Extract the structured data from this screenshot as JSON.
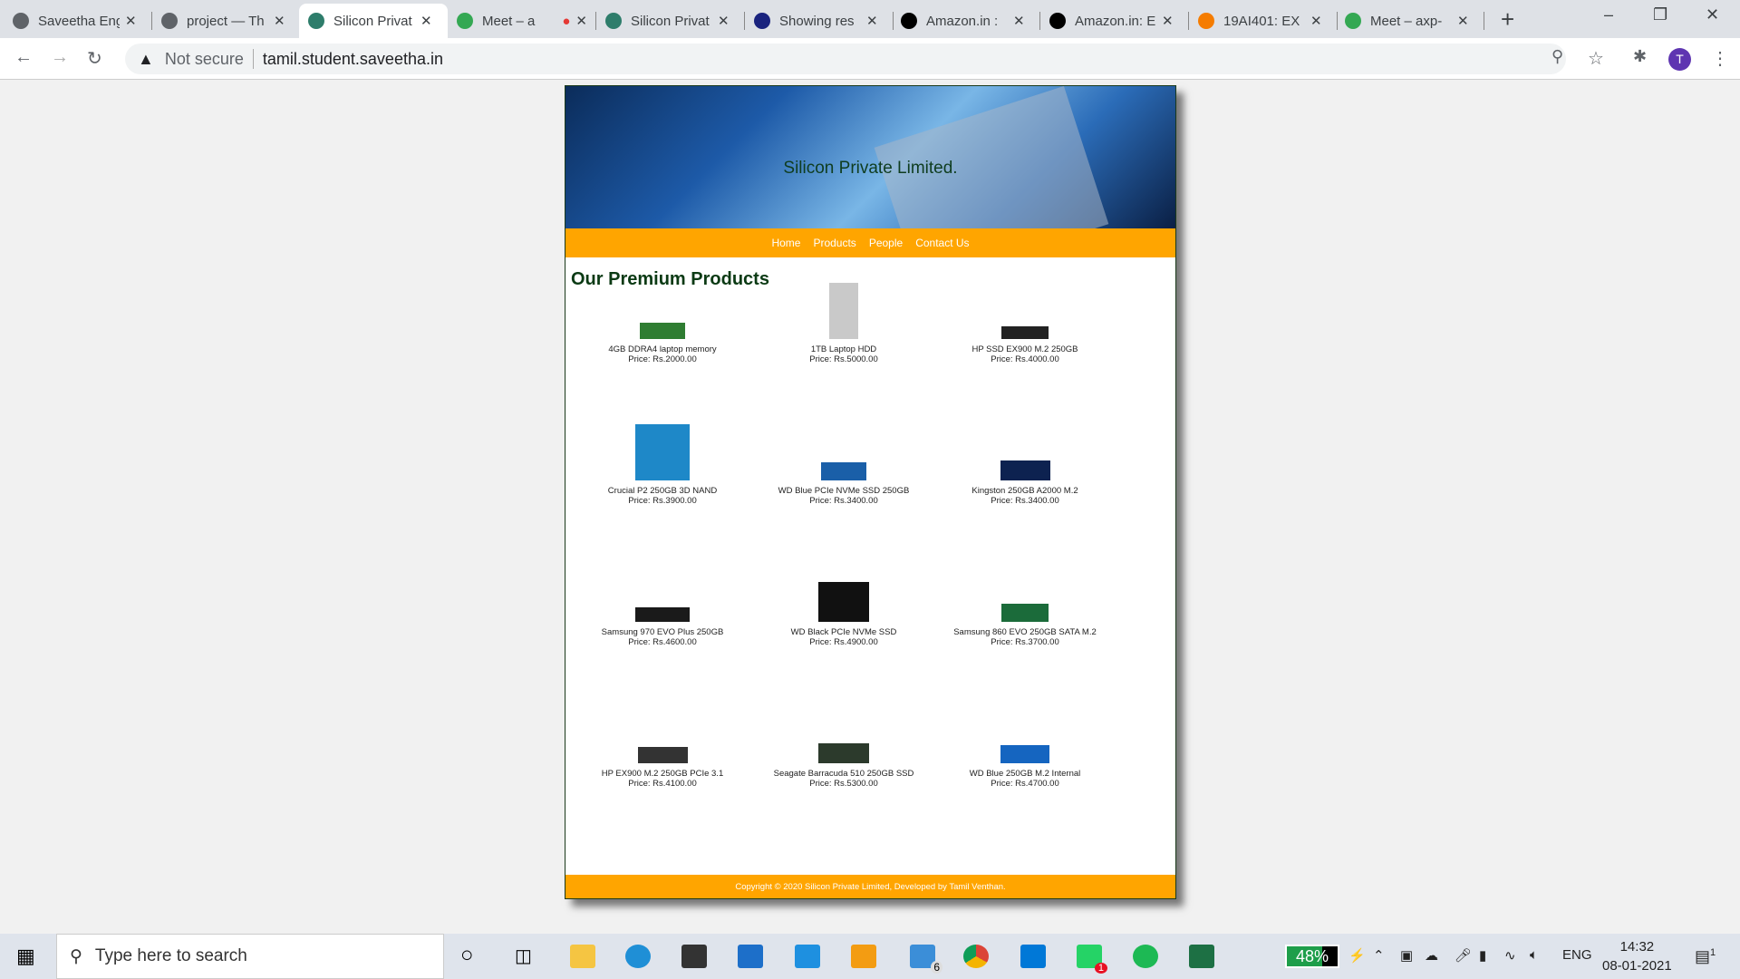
{
  "browser": {
    "tabs": [
      {
        "label": "Saveetha Eng",
        "icon": "globe-icon",
        "color": "#5f6368"
      },
      {
        "label": "project — Th",
        "icon": "globe-icon",
        "color": "#5f6368"
      },
      {
        "label": "Silicon Privat",
        "icon": "chip-icon",
        "color": "#2e7d6b",
        "active": true
      },
      {
        "label": "Meet – a",
        "icon": "meet-icon",
        "color": "#34a853",
        "recording": true
      },
      {
        "label": "Silicon Privat",
        "icon": "chip-icon",
        "color": "#2e7d6b"
      },
      {
        "label": "Showing res",
        "icon": "v-logo-icon",
        "color": "#1a237e"
      },
      {
        "label": "Amazon.in :",
        "icon": "amazon-icon",
        "color": "#000"
      },
      {
        "label": "Amazon.in: E",
        "icon": "amazon-icon",
        "color": "#000"
      },
      {
        "label": "19AI401: EX",
        "icon": "moodle-icon",
        "color": "#f57c00"
      },
      {
        "label": "Meet – axp-",
        "icon": "meet-icon",
        "color": "#34a853"
      }
    ],
    "security": "Not secure",
    "url": "tamil.student.saveetha.in",
    "profile_initial": "T"
  },
  "site": {
    "title": "Silicon Private Limited.",
    "nav": [
      "Home",
      "Products",
      "People",
      "Contact Us"
    ],
    "heading": "Our Premium Products",
    "products": [
      {
        "name": "4GB DDRA4 laptop memory",
        "price": "Price: Rs.2000.00",
        "color": "#2f7d32"
      },
      {
        "name": "1TB Laptop HDD",
        "price": "Price: Rs.5000.00",
        "color": "#c9c9c9"
      },
      {
        "name": "HP SSD EX900 M.2 250GB",
        "price": "Price: Rs.4000.00",
        "color": "#222"
      },
      {
        "name": "Crucial P2 250GB 3D NAND",
        "price": "Price: Rs.3900.00",
        "color": "#1e88c8"
      },
      {
        "name": "WD Blue PCIe NVMe SSD 250GB",
        "price": "Price: Rs.3400.00",
        "color": "#1a5fa8"
      },
      {
        "name": "Kingston 250GB A2000 M.2",
        "price": "Price: Rs.3400.00",
        "color": "#0d2250"
      },
      {
        "name": "Samsung 970 EVO Plus 250GB",
        "price": "Price: Rs.4600.00",
        "color": "#1a1a1a"
      },
      {
        "name": "WD Black PCIe NVMe SSD",
        "price": "Price: Rs.4900.00",
        "color": "#111"
      },
      {
        "name": "Samsung 860 EVO 250GB SATA M.2",
        "price": "Price: Rs.3700.00",
        "color": "#1b6b3a"
      },
      {
        "name": "HP EX900 M.2 250GB PCIe 3.1",
        "price": "Price: Rs.4100.00",
        "color": "#333"
      },
      {
        "name": "Seagate Barracuda 510 250GB SSD",
        "price": "Price: Rs.5300.00",
        "color": "#2c3a2c"
      },
      {
        "name": "WD Blue 250GB M.2 Internal",
        "price": "Price: Rs.4700.00",
        "color": "#1565c0"
      }
    ],
    "footer": "Copyright © 2020 Silicon Private Limited, Developed by Tamil Venthan."
  },
  "taskbar": {
    "search_placeholder": "Type here to search",
    "battery": "48%",
    "language": "ENG",
    "time": "14:32",
    "date": "08-01-2021",
    "explorer_badge": "6",
    "whatsapp_badge": "1",
    "notifications": "1"
  }
}
